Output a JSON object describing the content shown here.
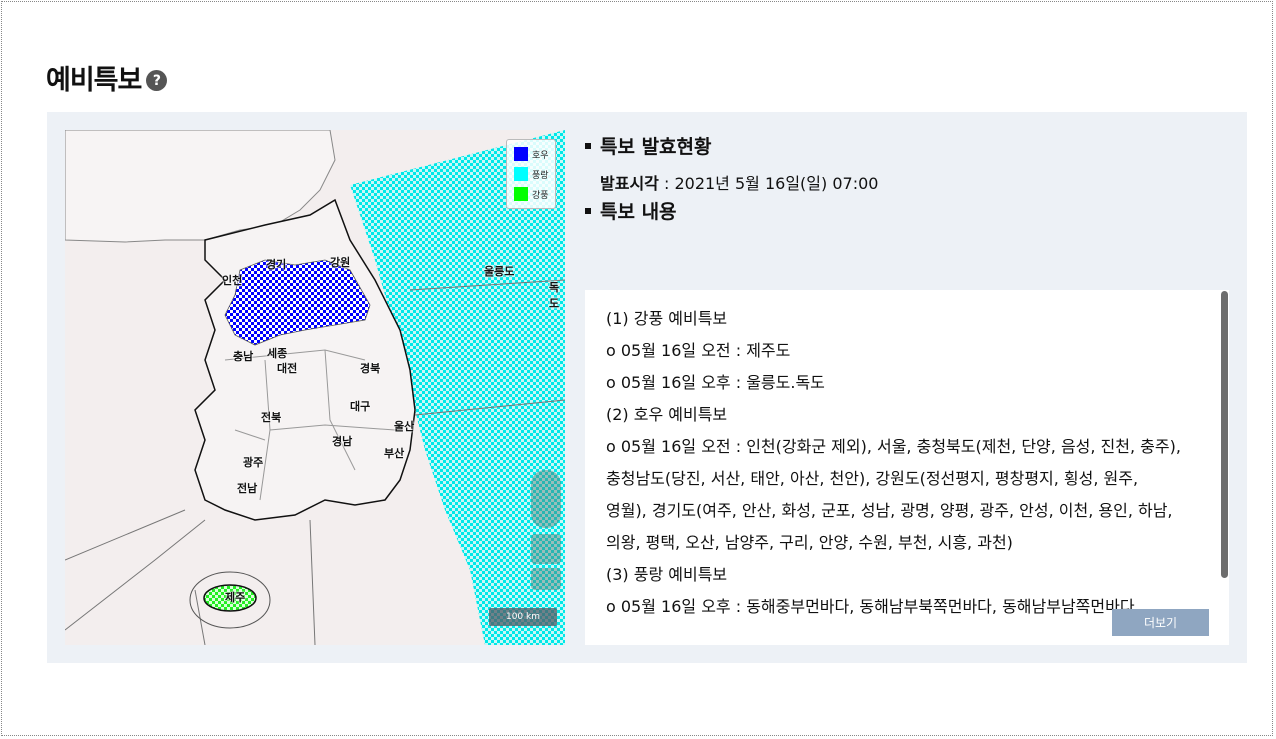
{
  "page": {
    "title": "예비특보",
    "help_icon": "?"
  },
  "map": {
    "labels": {
      "seoul_region": "경기",
      "incheon": "인천",
      "gangwon": "강원",
      "chungnam": "충남",
      "sejong": "세종",
      "daejeon": "대전",
      "gyeongbuk": "경북",
      "daegu": "대구",
      "jeonbuk": "전북",
      "ulsan": "울산",
      "gyeongnam": "경남",
      "busan": "부산",
      "gwangju": "광주",
      "jeonnam": "전남",
      "jeju": "제주",
      "ulleungdo": "울릉도",
      "dokdo": "독도"
    },
    "legend": [
      {
        "label": "호우",
        "color": "#0000ff"
      },
      {
        "label": "풍랑",
        "color": "#00ffff"
      },
      {
        "label": "강풍",
        "color": "#00ff00"
      }
    ],
    "scale": "100 km"
  },
  "status": {
    "heading": "특보 발효현황",
    "issued_label": "발표시각",
    "issued_value": " : 2021년 5월 16일(일) 07:00"
  },
  "content": {
    "heading": "특보 내용",
    "lines": [
      "(1) 강풍 예비특보",
      "o 05월 16일 오전 : 제주도",
      "o 05월 16일 오후 : 울릉도.독도",
      "(2) 호우 예비특보",
      "o 05월 16일 오전 : 인천(강화군 제외), 서울, 충청북도(제천, 단양, 음성, 진천, 충주),",
      "충청남도(당진, 서산, 태안, 아산, 천안), 강원도(정선평지, 평창평지, 횡성, 원주,",
      "영월), 경기도(여주, 안산, 화성, 군포, 성남, 광명, 양평, 광주, 안성, 이천, 용인, 하남,",
      "의왕, 평택, 오산, 남양주, 구리, 안양, 수원, 부천, 시흥, 과천)",
      "(3) 풍랑 예비특보",
      "o 05월 16일 오후 : 동해중부먼바다, 동해남부북쪽먼바다, 동해남부남쪽먼바다"
    ],
    "more_button": "더보기"
  }
}
